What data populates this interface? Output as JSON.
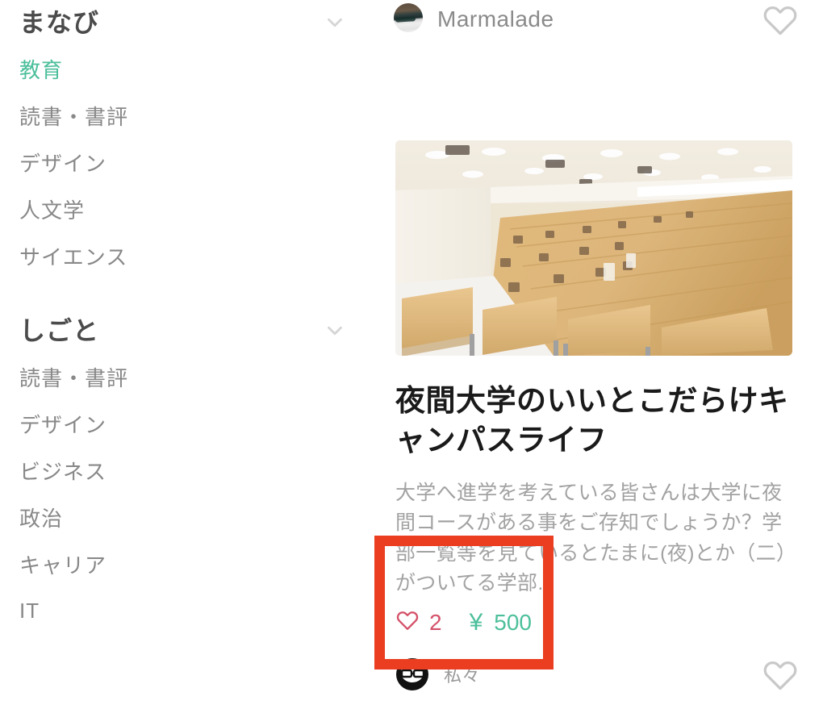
{
  "sidebar": {
    "groups": [
      {
        "title": "まなび",
        "toggle_icon": "chevron-down-icon",
        "items": [
          {
            "label": "教育",
            "active": true
          },
          {
            "label": "読書・書評",
            "active": false
          },
          {
            "label": "デザイン",
            "active": false
          },
          {
            "label": "人文学",
            "active": false
          },
          {
            "label": "サイエンス",
            "active": false
          }
        ]
      },
      {
        "title": "しごと",
        "toggle_icon": "chevron-down-icon",
        "items": [
          {
            "label": "読書・書評",
            "active": false
          },
          {
            "label": "デザイン",
            "active": false
          },
          {
            "label": "ビジネス",
            "active": false
          },
          {
            "label": "政治",
            "active": false
          },
          {
            "label": "キャリア",
            "active": false
          },
          {
            "label": "IT",
            "active": false
          }
        ]
      }
    ],
    "active_color": "#4cbf9b",
    "item_color": "#888888",
    "title_color": "#4b4b4b"
  },
  "feed": {
    "top_card": {
      "author_name": "Marmalade",
      "avatar_type": "photo",
      "like_icon": "heart-outline-icon"
    },
    "article_card": {
      "thumbnail_alt": "university lecture hall with tiered wooden seating",
      "title": "夜間大学のいいとこだらけキャンパスライフ",
      "description": "大学へ進学を考えている皆さんは大学に夜間コースがある事をご存知でしょうか？学部一覧等を見ているとたまに(夜)とか（二）がついてる学部.",
      "likes": {
        "icon": "heart-outline-icon",
        "count": "2",
        "color": "#d4526a"
      },
      "price": {
        "currency_symbol": "¥",
        "amount": "500",
        "color": "#4cbf9b"
      },
      "author_name": "私々",
      "avatar_type": "cartoon-glasses",
      "like_icon": "heart-outline-icon"
    }
  },
  "annotation": {
    "type": "highlight-rectangle",
    "color": "#eb3e21",
    "target": "likes-and-price-row"
  }
}
